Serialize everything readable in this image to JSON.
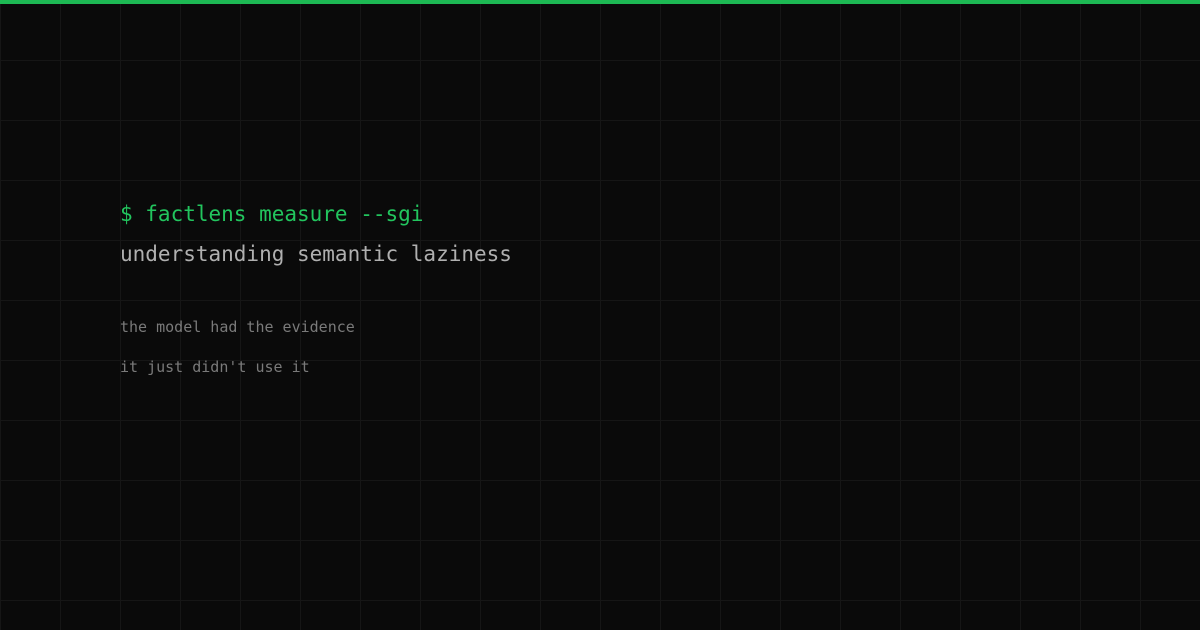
{
  "terminal": {
    "command": "$ factlens measure --sgi",
    "heading": "understanding semantic laziness",
    "lines": [
      "the model had the evidence",
      "it just didn't use it"
    ]
  },
  "colors": {
    "background": "#0a0a0a",
    "grid": "#161616",
    "accent": "#1db954",
    "command_text": "#22c55e",
    "heading_text": "#b0b0b0",
    "body_text": "#7a7a7a"
  }
}
